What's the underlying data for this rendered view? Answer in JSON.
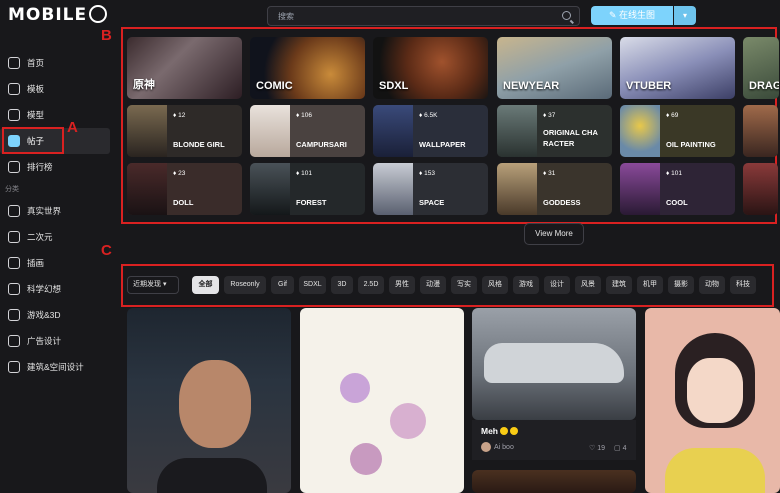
{
  "header": {
    "logo_text": "MOBILE",
    "search_placeholder": "搜索",
    "generate_label": "在线生图",
    "dropdown_icon": "chevron-down-icon"
  },
  "sidebar": {
    "items": [
      {
        "label": "首页",
        "icon": "home-icon"
      },
      {
        "label": "模板",
        "icon": "template-icon"
      },
      {
        "label": "模型",
        "icon": "model-icon"
      },
      {
        "label": "帖子",
        "icon": "image-icon"
      },
      {
        "label": "排行榜",
        "icon": "trophy-icon"
      }
    ],
    "section_label": "分类",
    "categories": [
      {
        "label": "真实世界",
        "icon": "mountain-icon"
      },
      {
        "label": "二次元",
        "icon": "cat-icon"
      },
      {
        "label": "插画",
        "icon": "palette-icon"
      },
      {
        "label": "科学幻想",
        "icon": "planet-icon"
      },
      {
        "label": "游戏&3D",
        "icon": "gamepad-icon"
      },
      {
        "label": "广告设计",
        "icon": "billboard-icon"
      },
      {
        "label": "建筑&空间设计",
        "icon": "building-icon"
      }
    ]
  },
  "annotations": {
    "a": "A",
    "b": "B",
    "c": "C"
  },
  "featured": [
    {
      "label": "原神"
    },
    {
      "label": "COMIC"
    },
    {
      "label": "SDXL"
    },
    {
      "label": "NEWYEAR"
    },
    {
      "label": "VTUBER"
    },
    {
      "label": "DRAG"
    }
  ],
  "tags": [
    {
      "name": "BLONDE GIRL",
      "count": "12"
    },
    {
      "name": "CAMPURSARI",
      "count": "106"
    },
    {
      "name": "WALLPAPER",
      "count": "6.5K"
    },
    {
      "name": "ORIGINAL CHA RACTER",
      "count": "37"
    },
    {
      "name": "OIL PAINTING",
      "count": "69"
    },
    {
      "name": "DOLL",
      "count": "23"
    },
    {
      "name": "FOREST",
      "count": "101"
    },
    {
      "name": "SPACE",
      "count": "153"
    },
    {
      "name": "GODDESS",
      "count": "31"
    },
    {
      "name": "COOL",
      "count": "101"
    }
  ],
  "view_more": "View More",
  "filters": {
    "sort": "近期发现",
    "chips": [
      "全部",
      "Roseonly",
      "Gif",
      "SDXL",
      "3D",
      "2.5D",
      "男性",
      "动漫",
      "写实",
      "风格",
      "游戏",
      "设计",
      "风景",
      "建筑",
      "机甲",
      "摄影",
      "动物",
      "科技"
    ]
  },
  "card3": {
    "title": "Meh",
    "author": "Ai boo",
    "likes": "19",
    "comments": "4"
  }
}
